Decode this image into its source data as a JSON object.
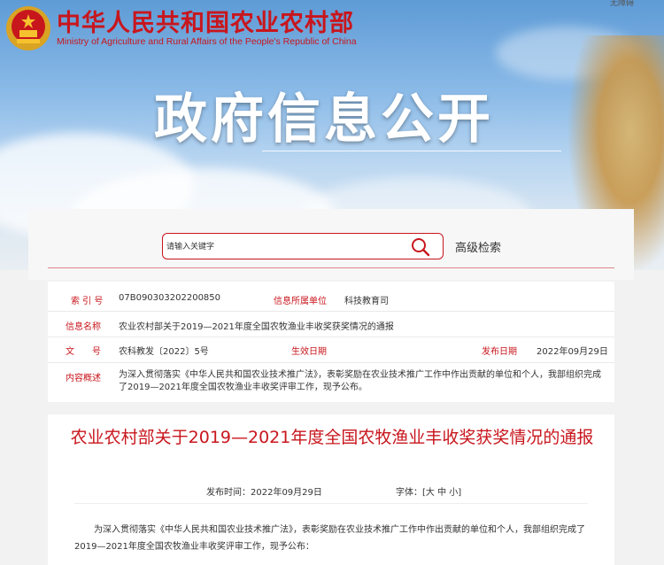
{
  "header": {
    "ministry_cn": "中华人民共和国农业农村部",
    "ministry_en": "Ministry of Agriculture and Rural Affairs of the People's Republic of China",
    "section_title": "政府信息公开",
    "top_right": "无障碍"
  },
  "search": {
    "placeholder": "请输入关键字",
    "advanced_label": "高级检索"
  },
  "info": {
    "index_label": "索 引 号",
    "index_value": "07B090303202200850",
    "org_label": "信息所属单位",
    "org_value": "科技教育司",
    "name_label": "信息名称",
    "name_value": "农业农村部关于2019—2021年度全国农牧渔业丰收奖获奖情况的通报",
    "doc_label": "文　　号",
    "doc_value": "农科教发〔2022〕5号",
    "effective_label": "生效日期",
    "effective_value": "",
    "publish_label": "发布日期",
    "publish_value": "2022年09月29日",
    "summary_label": "内容概述",
    "summary_value": "为深入贯彻落实《中华人民共和国农业技术推广法》，表彰奖励在农业技术推广工作中作出贡献的单位和个人，我部组织完成了2019—2021年度全国农牧渔业丰收奖评审工作，现予公布。"
  },
  "article": {
    "title": "农业农村部关于2019—2021年度全国农牧渔业丰收奖获奖情况的通报",
    "publish_time": "发布时间：2022年09月29日",
    "font_label": "字体：[大 中 小]",
    "body": "为深入贯彻落实《中华人民共和国农业技术推广法》，表彰奖励在农业技术推广工作中作出贡献的单位和个人，我部组织完成了2019—2021年度全国农牧渔业丰收奖评审工作，现予公布："
  },
  "colors": {
    "brand_red": "#c8161d"
  }
}
